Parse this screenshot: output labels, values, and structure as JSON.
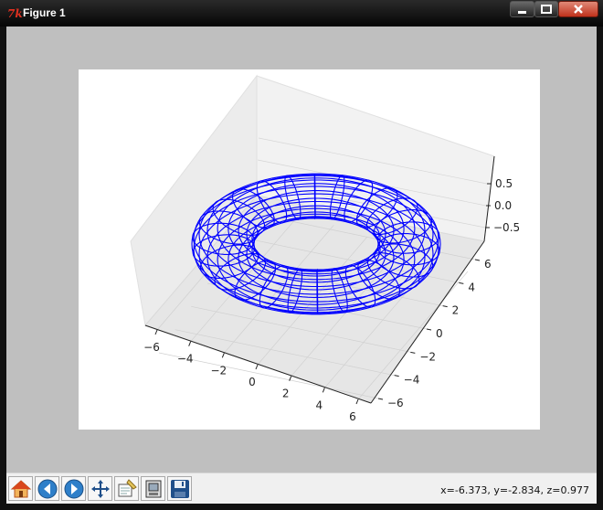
{
  "window": {
    "title": "Figure 1",
    "app_icon_glyph": "7k",
    "controls": {
      "minimize": "minimize-icon",
      "maximize": "maximize-icon",
      "close": "close-icon"
    }
  },
  "plot": {
    "type": "3d-wireframe",
    "surface": "torus",
    "line_color": "#0000ff",
    "pane_color": "#f2f2f2",
    "grid": true,
    "x_ticks": [
      "−6",
      "−4",
      "−2",
      "0",
      "2",
      "4",
      "6"
    ],
    "y_ticks": [
      "6",
      "4",
      "2",
      "0",
      "−2",
      "−4",
      "−6"
    ],
    "z_ticks": [
      "0.5",
      "0.0",
      "−0.5"
    ]
  },
  "toolbar": {
    "buttons": [
      {
        "name": "home-button",
        "icon": "home-icon"
      },
      {
        "name": "back-button",
        "icon": "back-arrow-icon"
      },
      {
        "name": "forward-button",
        "icon": "forward-arrow-icon"
      },
      {
        "name": "pan-button",
        "icon": "pan-cross-arrows-icon"
      },
      {
        "name": "zoom-button",
        "icon": "zoom-rect-icon"
      },
      {
        "name": "subplots-button",
        "icon": "subplots-config-icon"
      },
      {
        "name": "save-button",
        "icon": "floppy-disk-icon"
      }
    ],
    "coordinates": "x=-6.373, y=-2.834, z=0.977"
  }
}
